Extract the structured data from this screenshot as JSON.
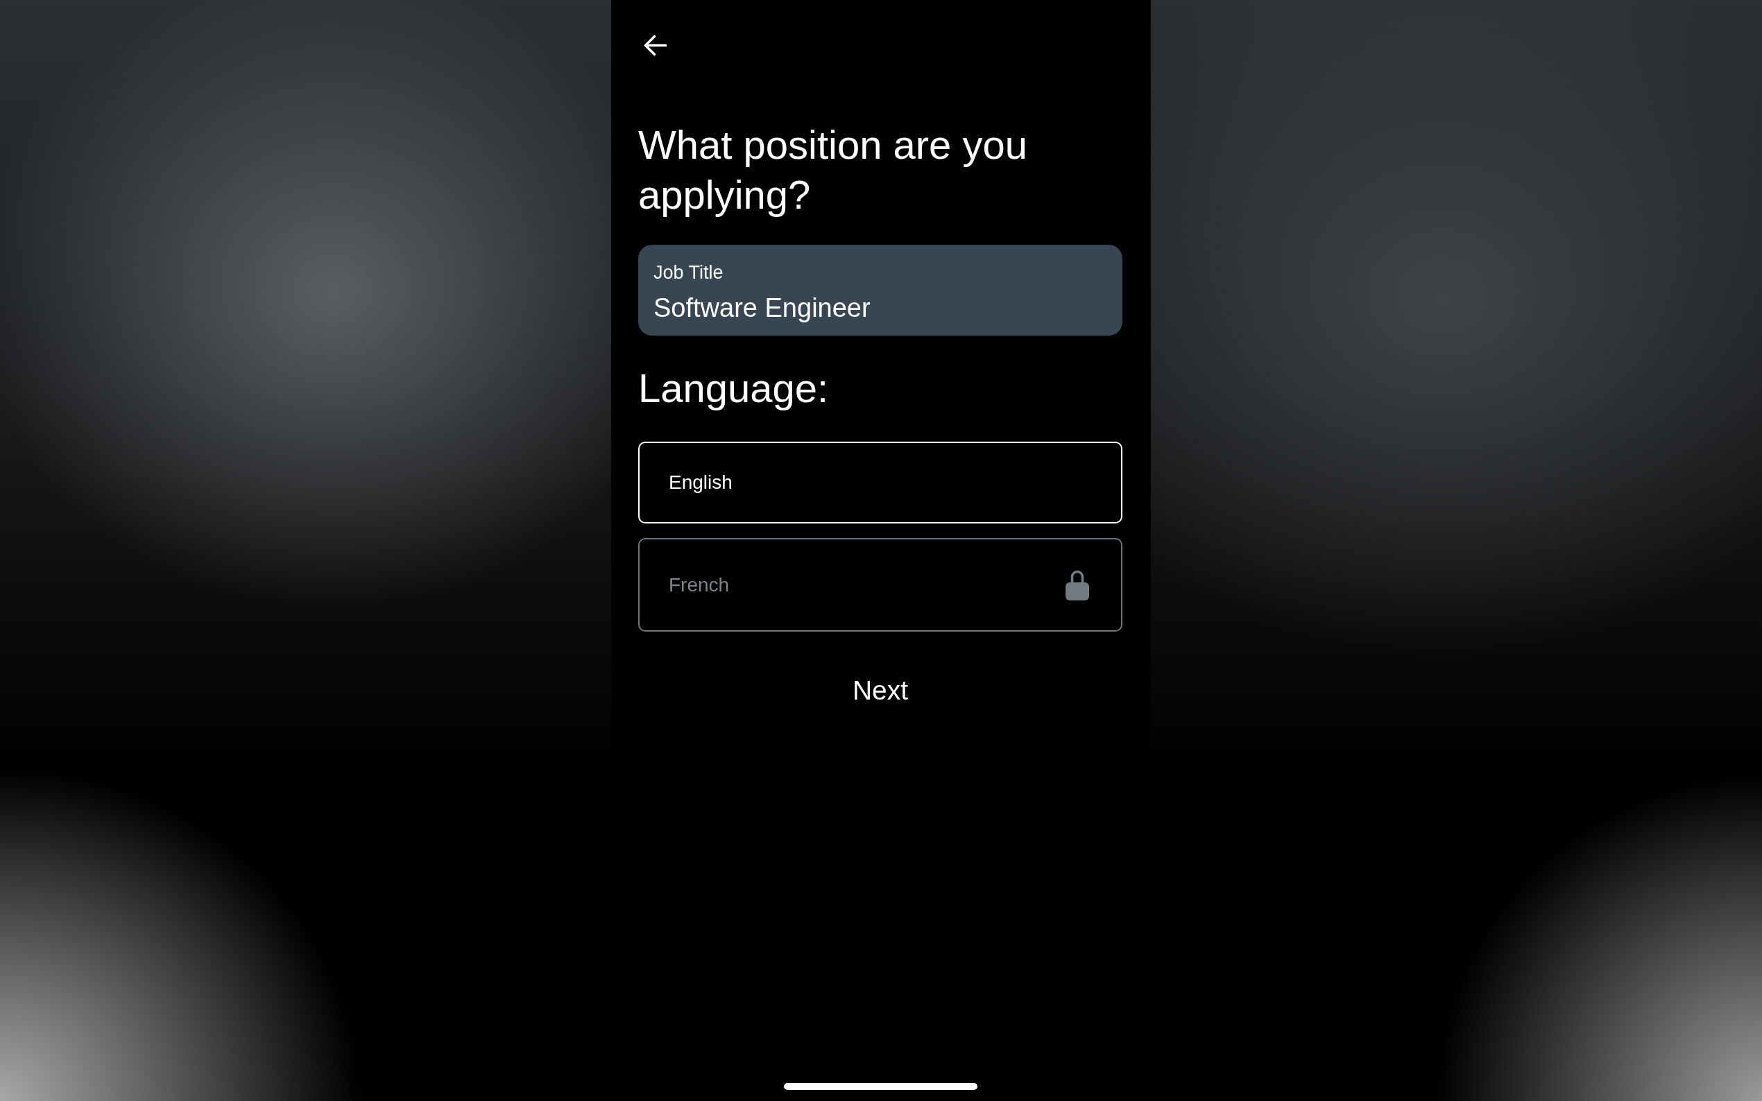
{
  "title": "What position are you applying?",
  "job_title_field": {
    "label": "Job Title",
    "value": "Software Engineer"
  },
  "language_heading": "Language:",
  "language_options": [
    {
      "label": "English",
      "locked": false
    },
    {
      "label": "French",
      "locked": true
    }
  ],
  "next_button": "Next"
}
